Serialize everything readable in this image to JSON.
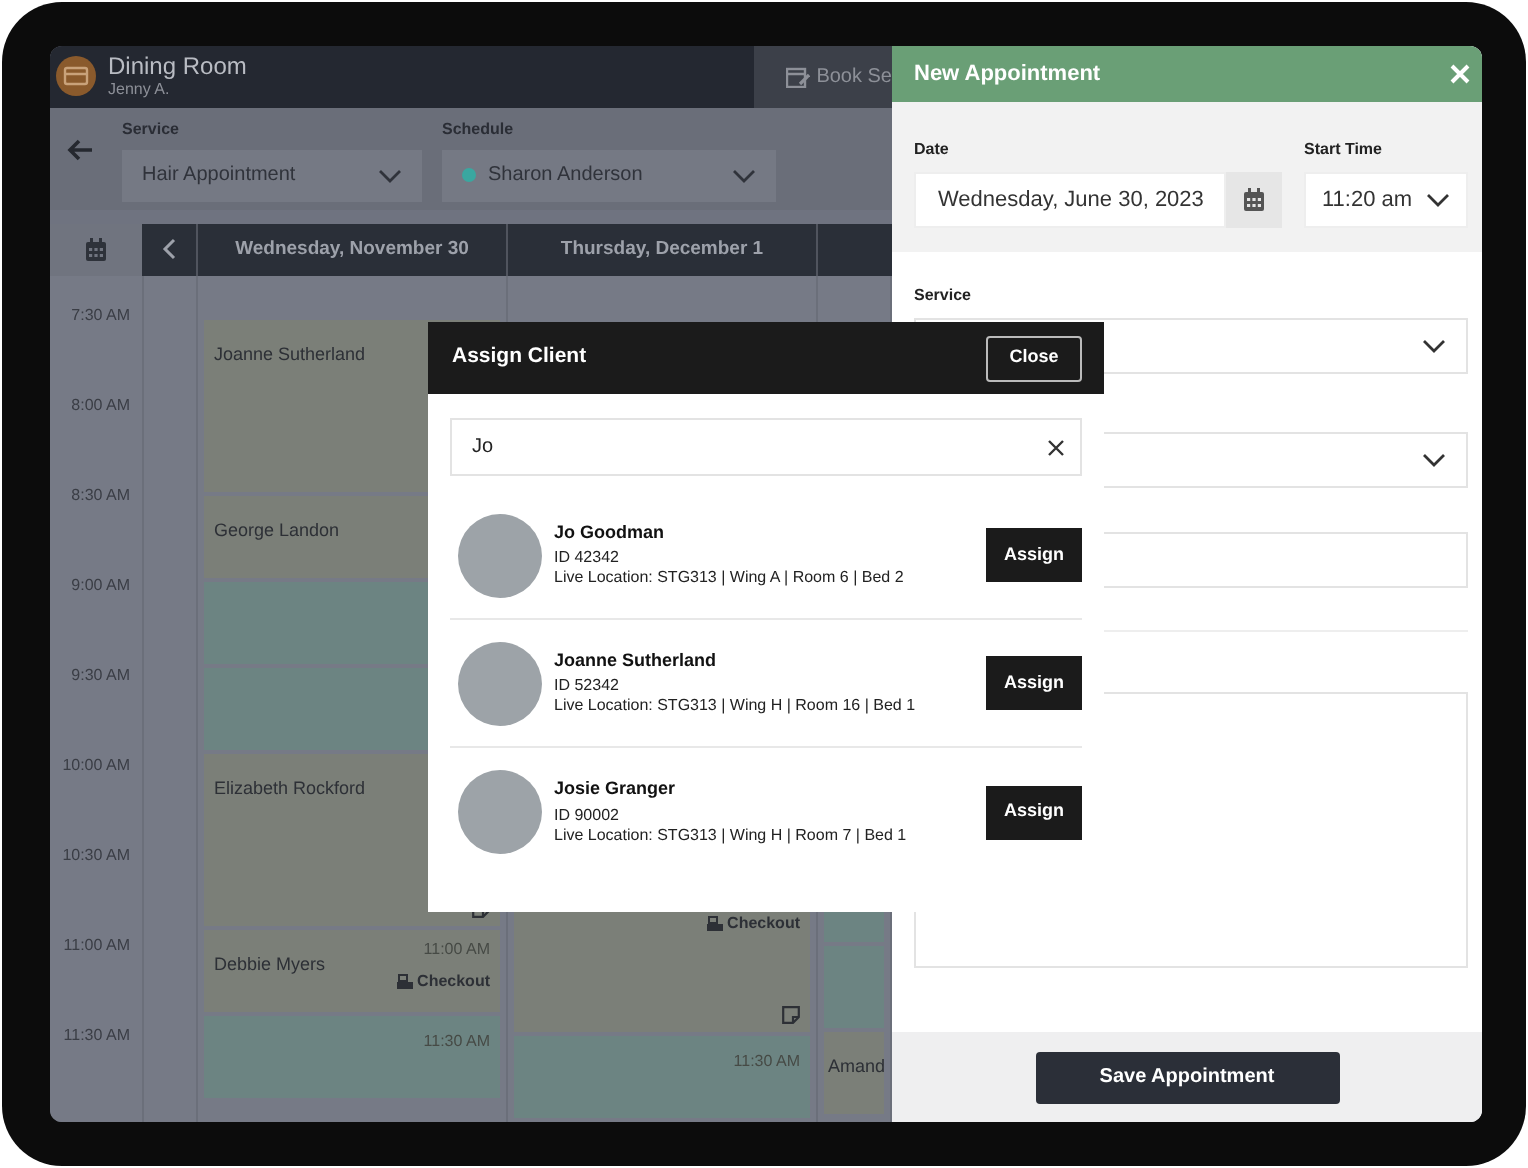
{
  "header": {
    "title": "Dining Room",
    "subtitle": "Jenny A.",
    "tab_label": "Book Se"
  },
  "filters": [
    {
      "label": "Service",
      "value": "Hair Appointment"
    },
    {
      "label": "Schedule",
      "value": "Sharon Anderson",
      "color": "#3aa7a0"
    }
  ],
  "calendar": {
    "days": [
      "Wednesday, November 30",
      "Thursday, December 1"
    ],
    "times": [
      "7:30 AM",
      "8:00 AM",
      "8:30 AM",
      "9:00 AM",
      "9:30 AM",
      "10:00 AM",
      "10:30 AM",
      "11:00 AM",
      "11:30 AM"
    ],
    "columns": [
      {
        "blocks": [
          {
            "kind": "booked",
            "long": true,
            "name": "Joanne Sutherland"
          },
          {
            "kind": "booked",
            "long": false,
            "name": "George Landon"
          },
          {
            "kind": "open",
            "long": false
          },
          {
            "kind": "open",
            "long": false
          },
          {
            "kind": "booked",
            "long": true,
            "name": "Elizabeth Rockford",
            "note": true
          },
          {
            "kind": "booked",
            "long": false,
            "name": "Debbie Myers",
            "time": "11:00 AM",
            "checkout": "Checkout"
          },
          {
            "kind": "open",
            "long": false,
            "time": "11:30 AM"
          }
        ]
      },
      {
        "starts_late": true,
        "blocks": [
          {
            "kind": "booked",
            "long": true,
            "checkout": "Checkout",
            "note": true
          },
          {
            "kind": "open",
            "long": false,
            "time": "11:30 AM"
          }
        ]
      },
      {
        "starts_late": true,
        "blocks": [
          {
            "kind": "open",
            "long": false
          },
          {
            "kind": "open",
            "long": false
          },
          {
            "kind": "booked",
            "long": false,
            "name": "Amand"
          }
        ]
      }
    ]
  },
  "panel": {
    "title": "New Appointment",
    "date_label": "Date",
    "date_value": "Wednesday, June 30, 2023",
    "time_label": "Start Time",
    "time_value": "11:20 am",
    "service_label": "Service",
    "save_button": "Save Appointment"
  },
  "dialog": {
    "title": "Assign Client",
    "close_button": "Close",
    "search_value": "Jo",
    "clients": [
      {
        "name": "Jo Goodman",
        "id": "ID 42342",
        "location": "Live Location: STG313 | Wing A | Room 6 | Bed 2",
        "button": "Assign"
      },
      {
        "name": "Joanne Sutherland",
        "id": "ID 52342",
        "location": "Live Location: STG313 | Wing H | Room 16 | Bed 1",
        "button": "Assign"
      },
      {
        "name": "Josie Granger",
        "id": "ID 90002",
        "location": "Live Location: STG313 | Wing H | Room 7 | Bed 1",
        "button": "Assign"
      }
    ]
  }
}
